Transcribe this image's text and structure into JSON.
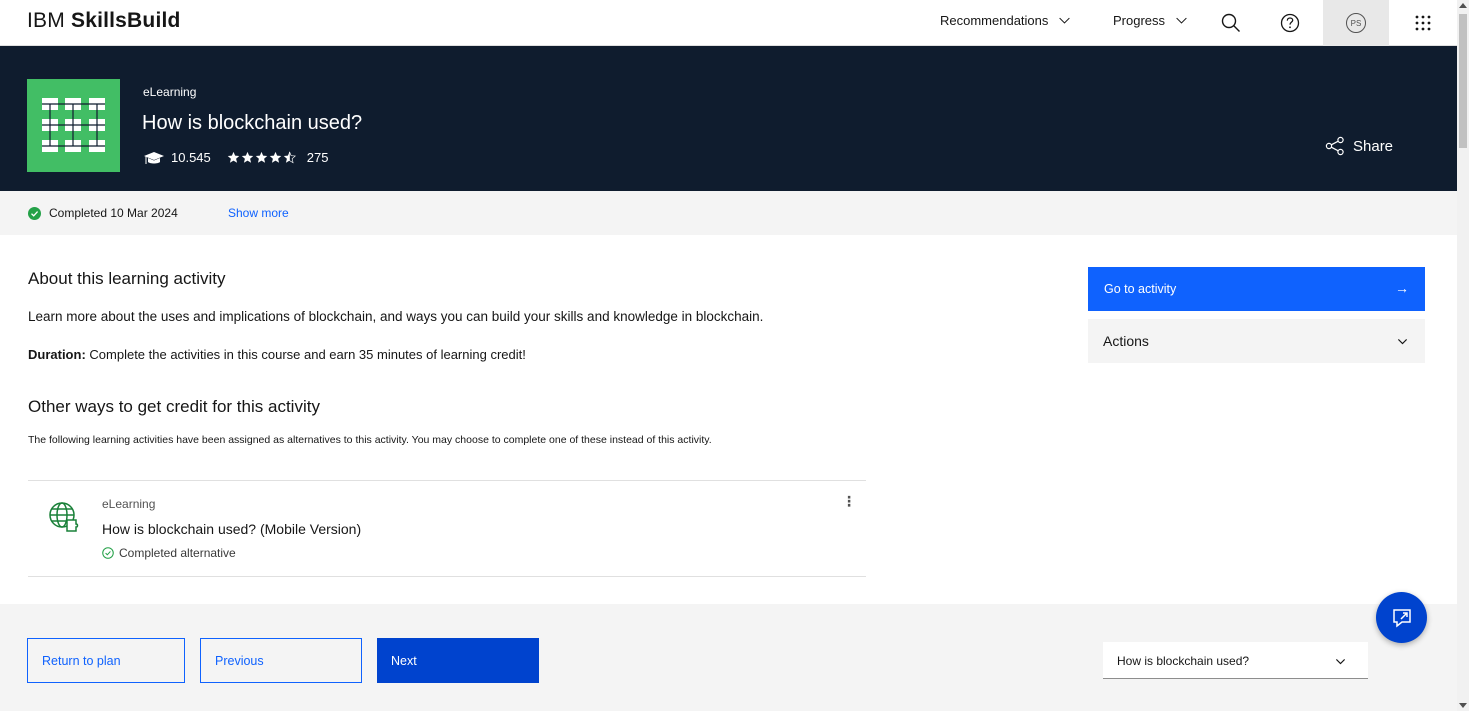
{
  "header": {
    "brand_regular": "IBM ",
    "brand_bold": "SkillsBuild",
    "nav": [
      {
        "label": "Recommendations"
      },
      {
        "label": "Progress"
      }
    ],
    "avatar_initials": "PS"
  },
  "hero": {
    "type": "eLearning",
    "title": "How is blockchain used?",
    "enrolled": "10.545",
    "rating": 4.5,
    "rating_max": 5,
    "reviews": "275",
    "share_label": "Share",
    "background_color": "#0f1c2e",
    "thumbnail_color": "#42be65"
  },
  "status": {
    "completed_text": "Completed 10 Mar 2024",
    "show_more": "Show more",
    "check_color": "#24a148"
  },
  "main": {
    "about_heading": "About this learning activity",
    "description": "Learn more about the uses and implications of blockchain, and ways you can build your skills and knowledge in blockchain.",
    "duration_label": "Duration:",
    "duration_text": " Complete the activities in this course and earn 35 minutes of learning credit!",
    "other_heading": "Other ways to get credit for this activity",
    "alternatives_text": "The following learning activities have been assigned as alternatives to this activity. You may choose to complete one of these instead of this activity.",
    "alternative": {
      "type": "eLearning",
      "title": "How is blockchain used? (Mobile Version)",
      "status": "Completed alternative"
    }
  },
  "side": {
    "go_label": "Go to activity",
    "go_arrow": "→",
    "actions_label": "Actions"
  },
  "footer": {
    "return_label": "Return to plan",
    "previous_label": "Previous",
    "next_label": "Next",
    "select_value": "How is blockchain used?"
  },
  "colors": {
    "primary": "#0f62fe",
    "primary_dark": "#0043ce",
    "panel": "#f4f4f4"
  }
}
